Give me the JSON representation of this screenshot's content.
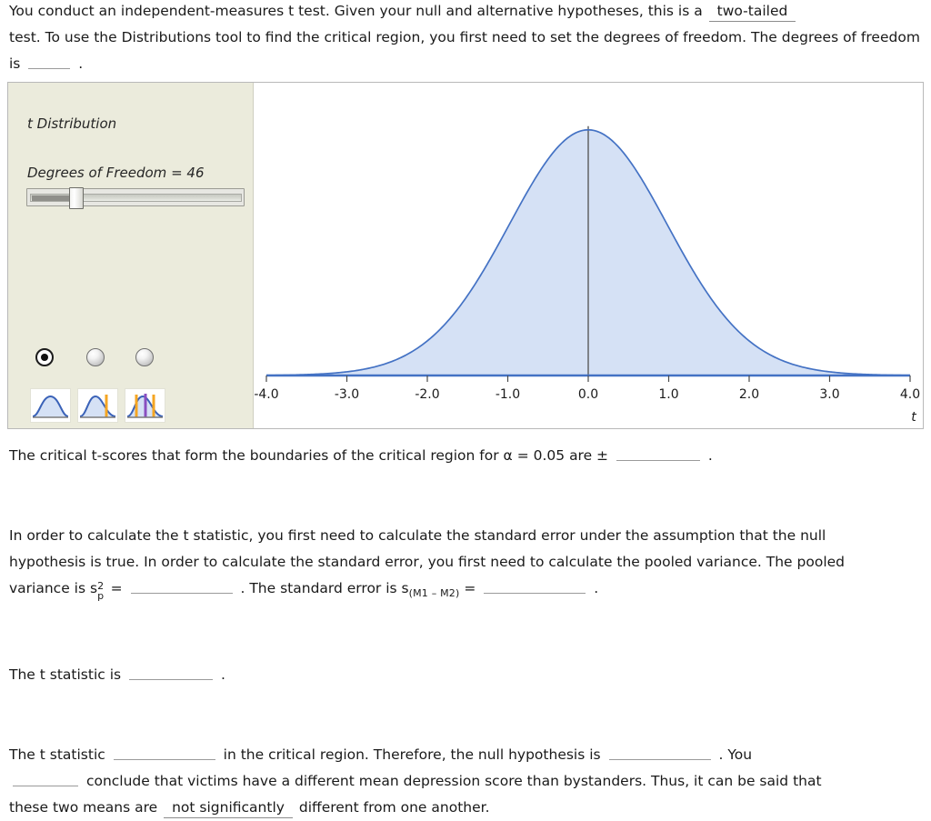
{
  "intro": {
    "part1": "You conduct an independent-measures t test. Given your null and alternative hypotheses, this is a",
    "answer_tail": "two-tailed",
    "part2": "test. To use the Distributions tool to find the critical region, you first need to set the degrees of freedom. The degrees of freedom is",
    "period": "."
  },
  "tool": {
    "title": "t Distribution",
    "dof_label": "Degrees of Freedom = 46",
    "dof_value": 46,
    "slider": {
      "min": 1,
      "max": 100,
      "value": 46
    },
    "modes": [
      {
        "name": "no-tails",
        "selected": true
      },
      {
        "name": "one-tail",
        "selected": false
      },
      {
        "name": "two-tails-center",
        "selected": false
      }
    ]
  },
  "chart_data": {
    "type": "line",
    "title": "t Distribution",
    "xlabel": "t",
    "ylabel": "",
    "xlim": [
      -4.0,
      4.0
    ],
    "ylim": [
      0,
      0.42
    ],
    "grid": false,
    "legend": "none",
    "xticks": [
      "-4.0",
      "-3.0",
      "-2.0",
      "-1.0",
      "0.0",
      "1.0",
      "2.0",
      "3.0",
      "4.0"
    ],
    "xtick_values": [
      -4.0,
      -3.0,
      -2.0,
      -1.0,
      0.0,
      1.0,
      2.0,
      3.0,
      4.0
    ],
    "series": [
      {
        "name": "t density (df = 46)",
        "x": [
          -4.0,
          -3.8,
          -3.6,
          -3.4,
          -3.2,
          -3.0,
          -2.8,
          -2.6,
          -2.4,
          -2.2,
          -2.0,
          -1.8,
          -1.6,
          -1.4,
          -1.2,
          -1.0,
          -0.8,
          -0.6,
          -0.4,
          -0.2,
          0.0,
          0.2,
          0.4,
          0.6,
          0.8,
          1.0,
          1.2,
          1.4,
          1.6,
          1.8,
          2.0,
          2.2,
          2.4,
          2.6,
          2.8,
          3.0,
          3.2,
          3.4,
          3.6,
          3.8,
          4.0
        ],
        "y": [
          0.0007,
          0.0011,
          0.0017,
          0.0026,
          0.004,
          0.0061,
          0.0092,
          0.0138,
          0.0206,
          0.0303,
          0.0437,
          0.0619,
          0.0857,
          0.1155,
          0.1513,
          0.192,
          0.2354,
          0.2784,
          0.3171,
          0.3475,
          0.3666,
          0.3475,
          0.3171,
          0.2784,
          0.2354,
          0.192,
          0.1513,
          0.1155,
          0.0857,
          0.0619,
          0.0437,
          0.0303,
          0.0206,
          0.0138,
          0.0092,
          0.0061,
          0.004,
          0.0026,
          0.0017,
          0.0011,
          0.0007
        ],
        "fill": true,
        "fill_color": "#d5e1f5",
        "line_color": "#4472c4"
      }
    ],
    "markers": [
      {
        "name": "center-line",
        "x": 0.0,
        "color": "#5a5a5a"
      }
    ]
  },
  "critical": {
    "text_before": "The critical t-scores that form the boundaries of the critical region for",
    "alpha": "α = 0.05",
    "text_mid": "are ±",
    "period": "."
  },
  "pooled": {
    "line1": "In order to calculate the t statistic, you first need to calculate the standard error under the assumption that the null",
    "line2": "hypothesis is true. In order to calculate the standard error, you first need to calculate the pooled variance. The pooled",
    "line3_a": "variance is",
    "symbol_s": "s",
    "symbol_sup": "2",
    "symbol_sub": "p",
    "equals": "=",
    "line3_b": ". The standard error is",
    "se_symbol": "s",
    "se_subscript": "(M1 – M2)",
    "se_equals": "=",
    "period": "."
  },
  "tstat": {
    "text": "The t statistic is",
    "period": "."
  },
  "conclusion": {
    "line1_a": "The t statistic",
    "line1_b": "in the critical region. Therefore, the null hypothesis is",
    "line1_c": ". You",
    "line2": "conclude that victims have a different mean depression score than bystanders. Thus, it can be said that",
    "line3_a": "these two means are",
    "line3_answer": "not significantly",
    "line3_b": "different from one another."
  }
}
